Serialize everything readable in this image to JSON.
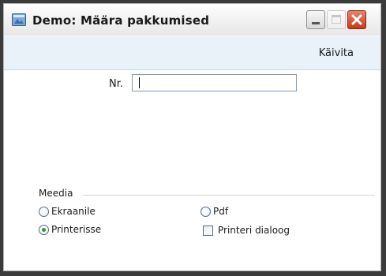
{
  "window": {
    "title": "Demo: Määra pakkumised"
  },
  "toolbar": {
    "run_label": "Käivita"
  },
  "form": {
    "nr_label": "Nr.",
    "nr_value": ""
  },
  "media": {
    "section_label": "Meedia",
    "options": {
      "screen": "Ekraanile",
      "printer": "Printerisse",
      "pdf": "Pdf",
      "printer_dialog": "Printeri dialoog"
    },
    "selected": "printer",
    "printer_dialog_checked": false
  },
  "colors": {
    "accent_radio_dot": "#2f9b2f",
    "toolbar_bg": "#eaf2f9",
    "close_button": "#c8381c"
  },
  "icons": {
    "app": "app-icon",
    "minimize": "minimize-icon",
    "maximize": "maximize-icon",
    "close": "close-icon"
  }
}
